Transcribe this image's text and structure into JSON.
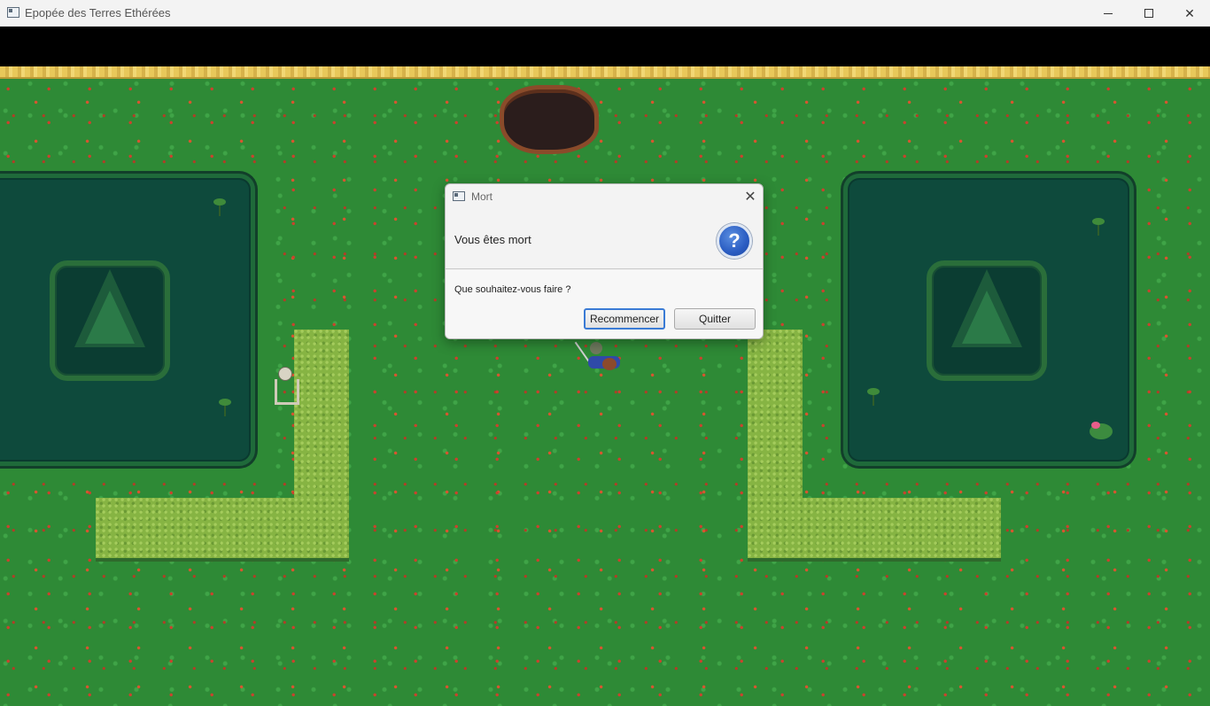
{
  "window": {
    "title": "Epopée des Terres Ethérées",
    "minimize_icon": "minimize-icon",
    "maximize_icon": "maximize-icon",
    "close_icon": "close-icon"
  },
  "game": {
    "scene": "grass-field",
    "elements": [
      "sand-strip",
      "pit",
      "pond-left",
      "pond-right",
      "hedge-left",
      "hedge-right",
      "skeleton",
      "hero"
    ]
  },
  "dialog": {
    "title": "Mort",
    "header_text": "Vous êtes mort",
    "icon": "question-icon",
    "icon_glyph": "?",
    "content_text": "Que souhaitez-vous faire ?",
    "buttons": {
      "restart": "Recommencer",
      "quit": "Quitter"
    },
    "close_glyph": "✕"
  },
  "colors": {
    "accent": "#3a7bd5",
    "grass": "#2e8a36",
    "pond": "#0e4a3c"
  }
}
